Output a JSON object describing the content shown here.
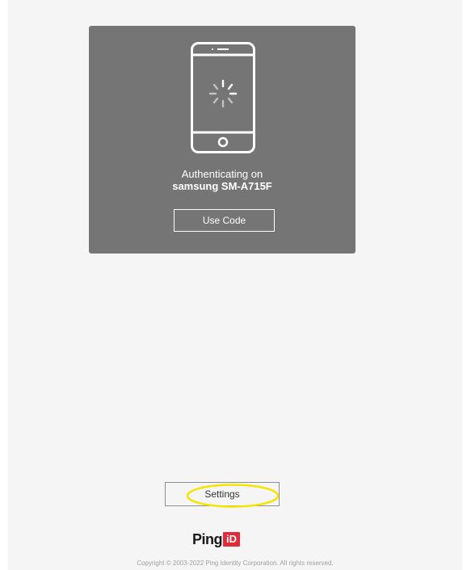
{
  "auth": {
    "line1": "Authenticating on",
    "device": "samsung SM-A715F",
    "use_code_label": "Use Code"
  },
  "settings": {
    "label": "Settings"
  },
  "logo": {
    "ping": "Ping",
    "id": "iD"
  },
  "footer": {
    "copyright": "Copyright © 2003-2022 Ping Identity Corporation. All rights reserved."
  },
  "colors": {
    "card": "#757575",
    "page": "#f5f5f5",
    "brand_red": "#e12b3a",
    "highlight": "#f2e600"
  },
  "icons": {
    "phone": "smartphone-icon",
    "spinner": "loading-spinner-icon"
  }
}
